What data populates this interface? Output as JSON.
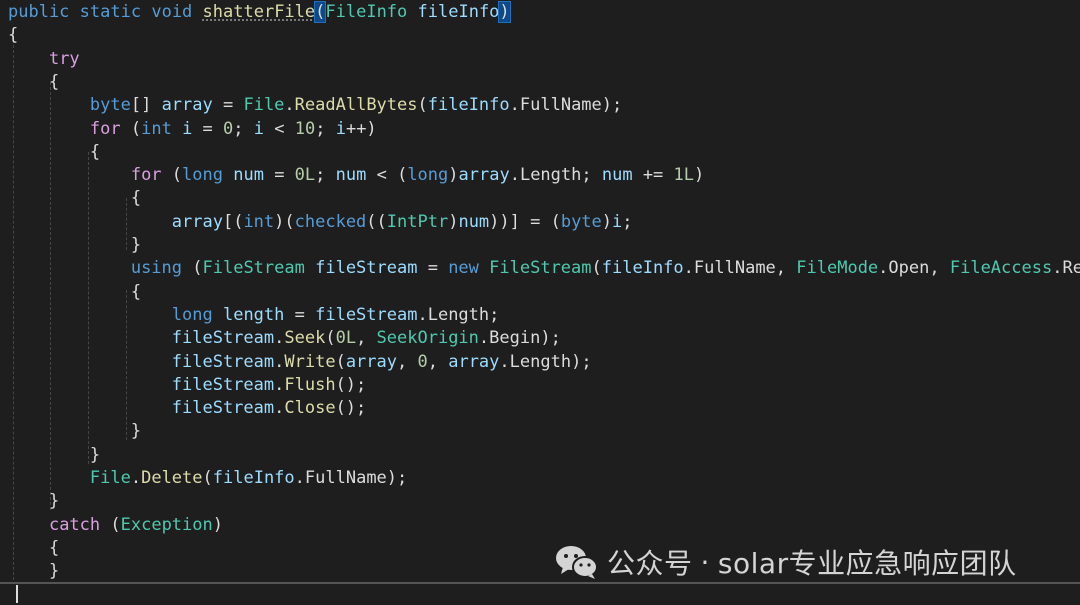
{
  "code": {
    "lines": [
      [
        {
          "t": "public",
          "c": "kw"
        },
        {
          "t": " "
        },
        {
          "t": "static",
          "c": "kw"
        },
        {
          "t": " "
        },
        {
          "t": "void",
          "c": "kw"
        },
        {
          "t": " "
        },
        {
          "t": "shatterFile",
          "c": "meth squig"
        },
        {
          "t": "(",
          "c": "hl"
        },
        {
          "t": "FileInfo",
          "c": "type"
        },
        {
          "t": " "
        },
        {
          "t": "fileInfo",
          "c": "var"
        },
        {
          "t": ")",
          "c": "hl"
        }
      ],
      [
        {
          "t": "{"
        }
      ],
      [
        {
          "t": "    "
        },
        {
          "t": "try",
          "c": "fkw"
        }
      ],
      [
        {
          "t": "    {"
        }
      ],
      [
        {
          "t": "        "
        },
        {
          "t": "byte",
          "c": "kw"
        },
        {
          "t": "[] "
        },
        {
          "t": "array",
          "c": "var"
        },
        {
          "t": " = "
        },
        {
          "t": "File",
          "c": "type"
        },
        {
          "t": "."
        },
        {
          "t": "ReadAllBytes",
          "c": "meth"
        },
        {
          "t": "("
        },
        {
          "t": "fileInfo",
          "c": "var"
        },
        {
          "t": "."
        },
        {
          "t": "FullName",
          "c": "prop"
        },
        {
          "t": ");"
        }
      ],
      [
        {
          "t": "        "
        },
        {
          "t": "for",
          "c": "fkw"
        },
        {
          "t": " ("
        },
        {
          "t": "int",
          "c": "kw"
        },
        {
          "t": " "
        },
        {
          "t": "i",
          "c": "var"
        },
        {
          "t": " = "
        },
        {
          "t": "0",
          "c": "num"
        },
        {
          "t": "; "
        },
        {
          "t": "i",
          "c": "var"
        },
        {
          "t": " < "
        },
        {
          "t": "10",
          "c": "num"
        },
        {
          "t": "; "
        },
        {
          "t": "i",
          "c": "var"
        },
        {
          "t": "++)"
        }
      ],
      [
        {
          "t": "        {"
        }
      ],
      [
        {
          "t": "            "
        },
        {
          "t": "for",
          "c": "fkw"
        },
        {
          "t": " ("
        },
        {
          "t": "long",
          "c": "kw"
        },
        {
          "t": " "
        },
        {
          "t": "num",
          "c": "var"
        },
        {
          "t": " = "
        },
        {
          "t": "0L",
          "c": "num"
        },
        {
          "t": "; "
        },
        {
          "t": "num",
          "c": "var"
        },
        {
          "t": " < ("
        },
        {
          "t": "long",
          "c": "kw"
        },
        {
          "t": ")"
        },
        {
          "t": "array",
          "c": "var"
        },
        {
          "t": "."
        },
        {
          "t": "Length",
          "c": "prop"
        },
        {
          "t": "; "
        },
        {
          "t": "num",
          "c": "var"
        },
        {
          "t": " += "
        },
        {
          "t": "1L",
          "c": "num"
        },
        {
          "t": ")"
        }
      ],
      [
        {
          "t": "            {"
        }
      ],
      [
        {
          "t": "                "
        },
        {
          "t": "array",
          "c": "var"
        },
        {
          "t": "[("
        },
        {
          "t": "int",
          "c": "kw"
        },
        {
          "t": ")("
        },
        {
          "t": "checked",
          "c": "kw"
        },
        {
          "t": "(("
        },
        {
          "t": "IntPtr",
          "c": "type"
        },
        {
          "t": ")"
        },
        {
          "t": "num",
          "c": "var"
        },
        {
          "t": "))] = ("
        },
        {
          "t": "byte",
          "c": "kw"
        },
        {
          "t": ")"
        },
        {
          "t": "i",
          "c": "var"
        },
        {
          "t": ";"
        }
      ],
      [
        {
          "t": "            }"
        }
      ],
      [
        {
          "t": "            "
        },
        {
          "t": "using",
          "c": "kw"
        },
        {
          "t": " ("
        },
        {
          "t": "FileStream",
          "c": "type"
        },
        {
          "t": " "
        },
        {
          "t": "fileStream",
          "c": "var"
        },
        {
          "t": " = "
        },
        {
          "t": "new",
          "c": "kw"
        },
        {
          "t": " "
        },
        {
          "t": "FileStream",
          "c": "type"
        },
        {
          "t": "("
        },
        {
          "t": "fileInfo",
          "c": "var"
        },
        {
          "t": "."
        },
        {
          "t": "FullName",
          "c": "prop"
        },
        {
          "t": ", "
        },
        {
          "t": "FileMode",
          "c": "type"
        },
        {
          "t": "."
        },
        {
          "t": "Open",
          "c": "prop"
        },
        {
          "t": ", "
        },
        {
          "t": "FileAccess",
          "c": "type"
        },
        {
          "t": "."
        },
        {
          "t": "ReadWrite",
          "c": "prop"
        },
        {
          "t": "))"
        }
      ],
      [
        {
          "t": "            {"
        }
      ],
      [
        {
          "t": "                "
        },
        {
          "t": "long",
          "c": "kw"
        },
        {
          "t": " "
        },
        {
          "t": "length",
          "c": "var"
        },
        {
          "t": " = "
        },
        {
          "t": "fileStream",
          "c": "var"
        },
        {
          "t": "."
        },
        {
          "t": "Length",
          "c": "prop"
        },
        {
          "t": ";"
        }
      ],
      [
        {
          "t": "                "
        },
        {
          "t": "fileStream",
          "c": "var"
        },
        {
          "t": "."
        },
        {
          "t": "Seek",
          "c": "meth"
        },
        {
          "t": "("
        },
        {
          "t": "0L",
          "c": "num"
        },
        {
          "t": ", "
        },
        {
          "t": "SeekOrigin",
          "c": "type"
        },
        {
          "t": "."
        },
        {
          "t": "Begin",
          "c": "prop"
        },
        {
          "t": ");"
        }
      ],
      [
        {
          "t": "                "
        },
        {
          "t": "fileStream",
          "c": "var"
        },
        {
          "t": "."
        },
        {
          "t": "Write",
          "c": "meth"
        },
        {
          "t": "("
        },
        {
          "t": "array",
          "c": "var"
        },
        {
          "t": ", "
        },
        {
          "t": "0",
          "c": "num"
        },
        {
          "t": ", "
        },
        {
          "t": "array",
          "c": "var"
        },
        {
          "t": "."
        },
        {
          "t": "Length",
          "c": "prop"
        },
        {
          "t": ");"
        }
      ],
      [
        {
          "t": "                "
        },
        {
          "t": "fileStream",
          "c": "var"
        },
        {
          "t": "."
        },
        {
          "t": "Flush",
          "c": "meth"
        },
        {
          "t": "();"
        }
      ],
      [
        {
          "t": "                "
        },
        {
          "t": "fileStream",
          "c": "var"
        },
        {
          "t": "."
        },
        {
          "t": "Close",
          "c": "meth"
        },
        {
          "t": "();"
        }
      ],
      [
        {
          "t": "            }"
        }
      ],
      [
        {
          "t": "        }"
        }
      ],
      [
        {
          "t": "        "
        },
        {
          "t": "File",
          "c": "type"
        },
        {
          "t": "."
        },
        {
          "t": "Delete",
          "c": "meth"
        },
        {
          "t": "("
        },
        {
          "t": "fileInfo",
          "c": "var"
        },
        {
          "t": "."
        },
        {
          "t": "FullName",
          "c": "prop"
        },
        {
          "t": ");"
        }
      ],
      [
        {
          "t": "    }"
        }
      ],
      [
        {
          "t": "    "
        },
        {
          "t": "catch",
          "c": "fkw"
        },
        {
          "t": " ("
        },
        {
          "t": "Exception",
          "c": "type"
        },
        {
          "t": ")"
        }
      ],
      [
        {
          "t": "    {"
        }
      ],
      [
        {
          "t": "    }"
        }
      ],
      [
        {
          "t": "}"
        }
      ]
    ]
  },
  "watermark": {
    "prefix": "公众号",
    "separator": "·",
    "account": "solar专业应急响应团队",
    "icon": "wechat-icon"
  },
  "colors": {
    "background": "#1e1e1e",
    "keyword": "#569cd6",
    "control_keyword": "#d8a0df",
    "type": "#4ec9b0",
    "method": "#dcdcaa",
    "variable": "#9cdcfe",
    "number": "#b5cea8",
    "text": "#dcdcdc"
  }
}
